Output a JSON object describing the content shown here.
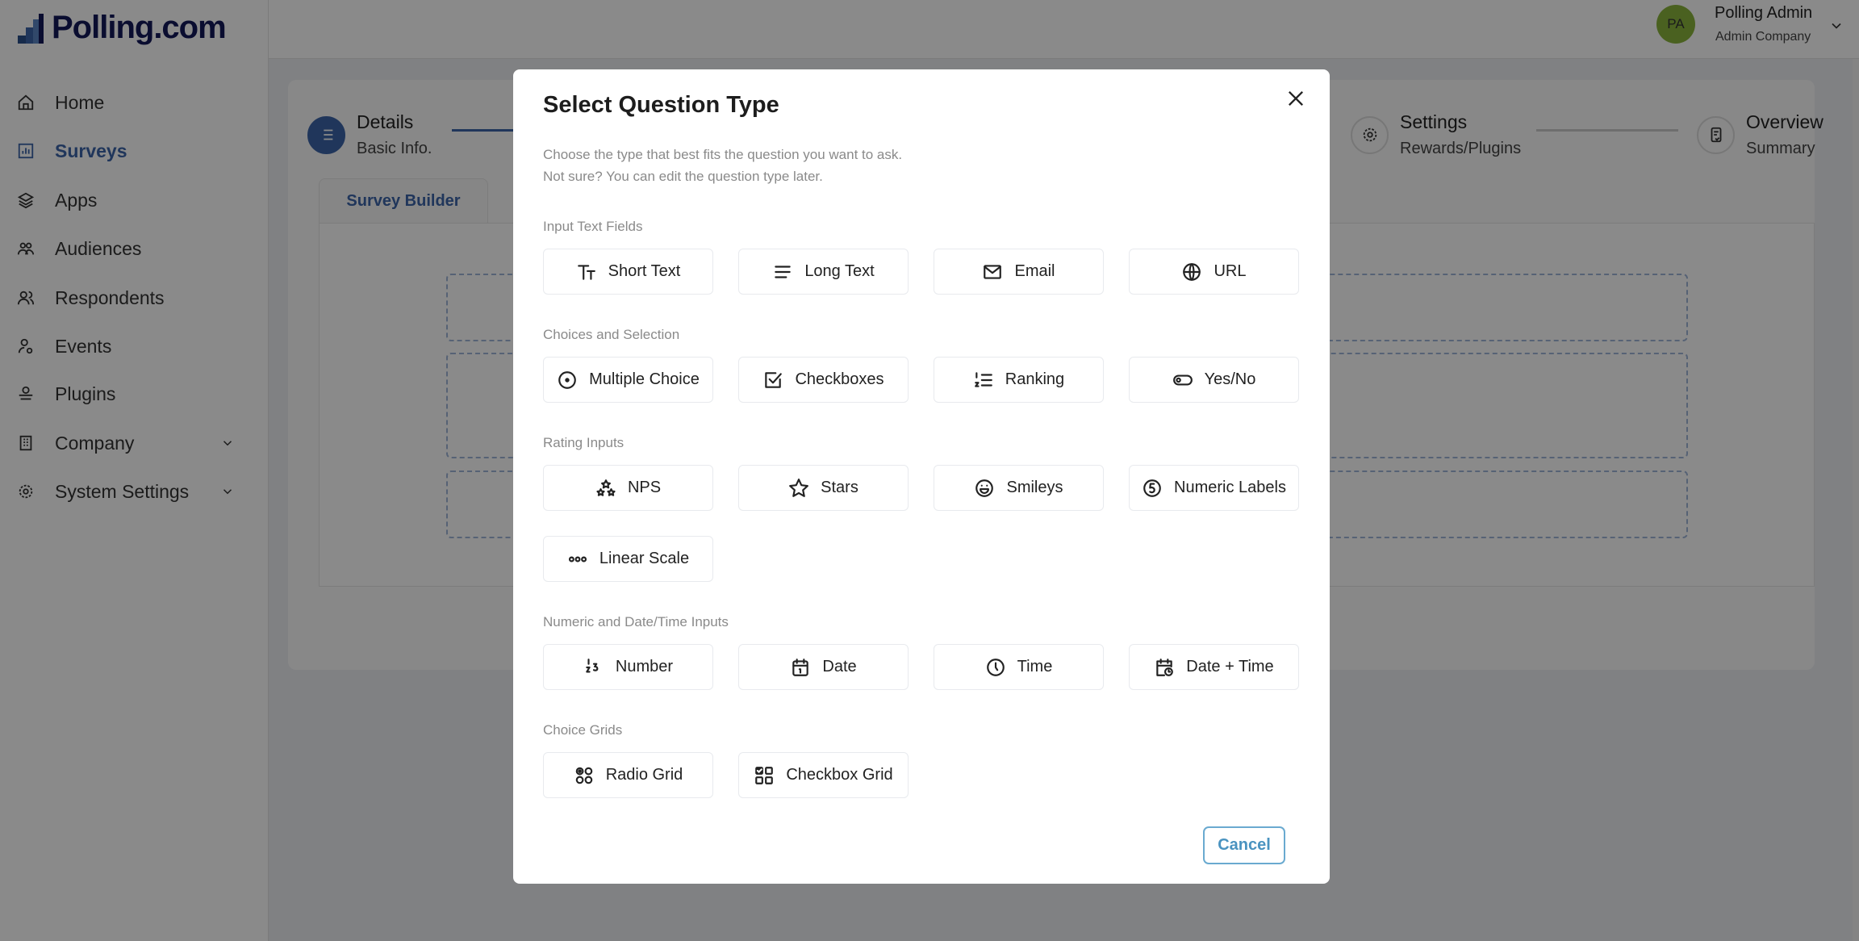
{
  "brand": {
    "name": "Polling.com"
  },
  "sidebar": {
    "items": [
      {
        "label": "Home",
        "icon": "home-icon"
      },
      {
        "label": "Surveys",
        "icon": "chart-icon",
        "active": true
      },
      {
        "label": "Apps",
        "icon": "layers-icon"
      },
      {
        "label": "Audiences",
        "icon": "users-icon"
      },
      {
        "label": "Respondents",
        "icon": "user-group-icon"
      },
      {
        "label": "Events",
        "icon": "user-event-icon"
      },
      {
        "label": "Plugins",
        "icon": "plug-icon"
      },
      {
        "label": "Company",
        "icon": "building-icon",
        "expandable": true
      },
      {
        "label": "System Settings",
        "icon": "gear-icon",
        "expandable": true
      }
    ]
  },
  "user": {
    "initials": "PA",
    "name": "Polling Admin",
    "company": "Admin Company",
    "avatar_color": "#8ab43c"
  },
  "stepper": [
    {
      "title": "Details",
      "subtitle": "Basic Info."
    },
    {
      "title": "Settings",
      "subtitle": "Rewards/Plugins"
    },
    {
      "title": "Overview",
      "subtitle": "Summary"
    }
  ],
  "builder": {
    "tab": "Survey Builder"
  },
  "modal": {
    "title": "Select Question Type",
    "description": [
      "Choose the type that best fits the question you want to ask.",
      "Not sure? You can edit the question type later."
    ],
    "sections": [
      {
        "label": "Input Text Fields",
        "options": [
          {
            "label": "Short Text",
            "icon": "text-size-icon"
          },
          {
            "label": "Long Text",
            "icon": "lines-icon"
          },
          {
            "label": "Email",
            "icon": "mail-icon"
          },
          {
            "label": "URL",
            "icon": "globe-www-icon"
          }
        ]
      },
      {
        "label": "Choices and Selection",
        "options": [
          {
            "label": "Multiple Choice",
            "icon": "radio-icon"
          },
          {
            "label": "Checkboxes",
            "icon": "checkbox-icon"
          },
          {
            "label": "Ranking",
            "icon": "ordered-list-icon"
          },
          {
            "label": "Yes/No",
            "icon": "toggle-icon"
          }
        ]
      },
      {
        "label": "Rating Inputs",
        "options": [
          {
            "label": "NPS",
            "icon": "stars-group-icon"
          },
          {
            "label": "Stars",
            "icon": "star-icon"
          },
          {
            "label": "Smileys",
            "icon": "smiley-icon"
          },
          {
            "label": "Numeric Labels",
            "icon": "number-five-circle-icon"
          },
          {
            "label": "Linear Scale",
            "icon": "dots-icon"
          }
        ]
      },
      {
        "label": "Numeric and Date/Time Inputs",
        "options": [
          {
            "label": "Number",
            "icon": "numbers-icon"
          },
          {
            "label": "Date",
            "icon": "calendar-icon"
          },
          {
            "label": "Time",
            "icon": "clock-icon"
          },
          {
            "label": "Date + Time",
            "icon": "calendar-clock-icon"
          }
        ]
      },
      {
        "label": "Choice Grids",
        "options": [
          {
            "label": "Radio Grid",
            "icon": "radio-grid-icon"
          },
          {
            "label": "Checkbox Grid",
            "icon": "checkbox-grid-icon"
          }
        ]
      }
    ],
    "cancel_label": "Cancel"
  },
  "colors": {
    "brand": "#14185a",
    "accent": "#3c64a8",
    "cancel": "#4a93c0"
  }
}
